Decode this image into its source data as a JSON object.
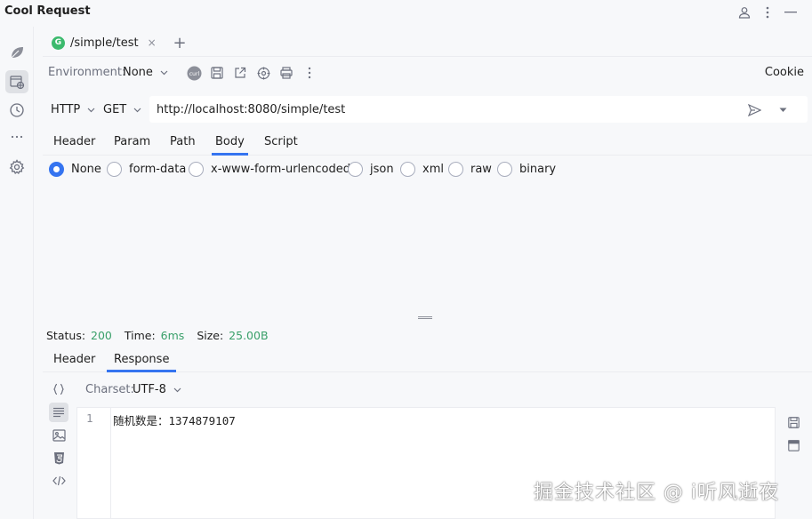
{
  "app": {
    "title": "Cool Request"
  },
  "tab": {
    "method_badge": "G",
    "label": "/simple/test",
    "close": "×",
    "add": "+"
  },
  "env": {
    "label": "Environment:",
    "value": "None",
    "cookie": "Cookie"
  },
  "request": {
    "protocol": "HTTP",
    "method": "GET",
    "url": "http://localhost:8080/simple/test"
  },
  "request_tabs": [
    "Header",
    "Param",
    "Path",
    "Body",
    "Script"
  ],
  "active_request_tab": "Body",
  "body_types": [
    "None",
    "form-data",
    "x-www-form-urlencoded",
    "json",
    "xml",
    "raw",
    "binary"
  ],
  "selected_body_type": "None",
  "status": {
    "status_label": "Status:",
    "status_value": "200",
    "time_label": "Time:",
    "time_value": "6ms",
    "size_label": "Size:",
    "size_value": "25.00B"
  },
  "response_tabs": [
    "Header",
    "Response"
  ],
  "active_response_tab": "Response",
  "charset": {
    "label": "Charset:",
    "value": "UTF-8"
  },
  "response_body": {
    "line_number": "1",
    "text": "随机数是：1374879107"
  },
  "watermark": "掘金技术社区 @ i听风逝夜",
  "colors": {
    "accent": "#3574f0",
    "success": "#3aa06a",
    "method_badge": "#3bba6d"
  }
}
